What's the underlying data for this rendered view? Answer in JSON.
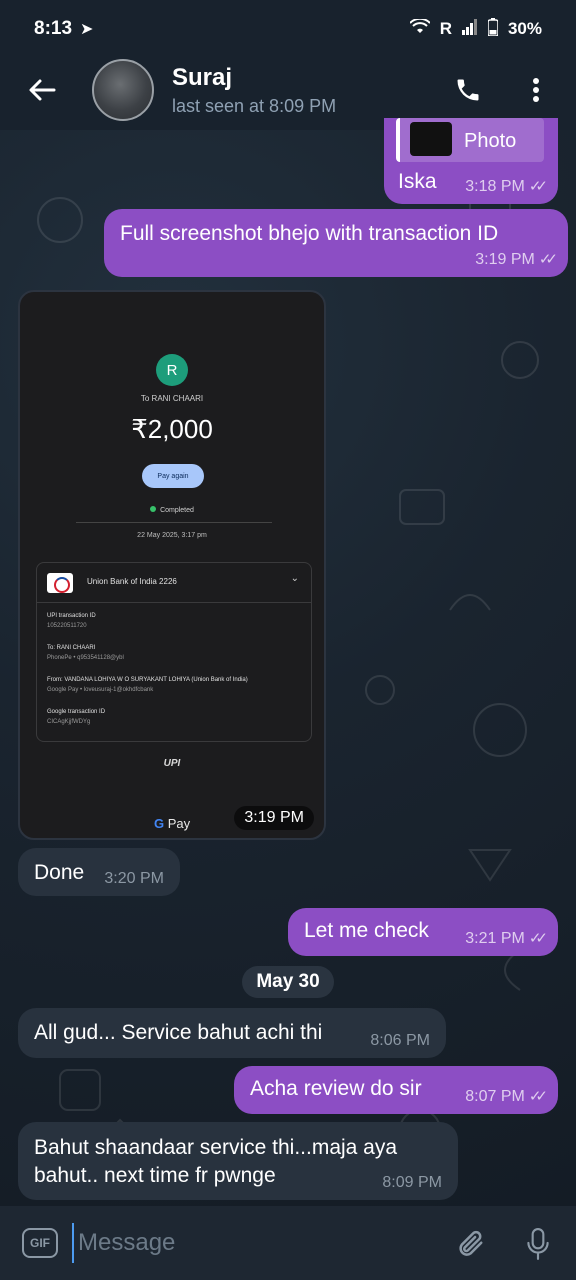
{
  "status_bar": {
    "time": "8:13",
    "network": "R",
    "battery": "30%"
  },
  "header": {
    "contact_name": "Suraj",
    "last_seen": "last seen at 8:09 PM"
  },
  "messages": [
    {
      "id": "m1",
      "reply_label": "Photo",
      "text": "Iska",
      "time": "3:18 PM",
      "direction": "out"
    },
    {
      "id": "m2",
      "text": "Full screenshot bhejo with transaction ID",
      "time": "3:19 PM",
      "direction": "out"
    },
    {
      "id": "m3",
      "type": "image",
      "time": "3:19 PM",
      "direction": "in"
    },
    {
      "id": "m4",
      "text": "Done",
      "time": "3:20 PM",
      "direction": "in"
    },
    {
      "id": "m5",
      "text": "Let me check",
      "time": "3:21 PM",
      "direction": "out"
    },
    {
      "id": "m6",
      "text": "All gud... Service bahut achi thi",
      "time": "8:06 PM",
      "direction": "in"
    },
    {
      "id": "m7",
      "text": "Acha review do sir",
      "time": "8:07 PM",
      "direction": "out"
    },
    {
      "id": "m8",
      "text_line1": "Bahut shaandaar service thi...maja aya",
      "text_line2": "bahut.. next time fr pwnge",
      "time": "8:09 PM",
      "direction": "in"
    }
  ],
  "date_chip": "May 30",
  "payment_screenshot": {
    "avatar_letter": "R",
    "to": "To RANI  CHAARI",
    "amount": "₹2,000",
    "pay_again": "Pay again",
    "status": "Completed",
    "date": "22 May 2025, 3:17 pm",
    "bank": "Union Bank of India 2226",
    "upi_label": "UPI transaction ID",
    "upi_value": "105220511720",
    "to_label": "To: RANI  CHAARI",
    "to_value": "PhonePe • q953541128@ybl",
    "from_label": "From: VANDANA LOHIYA W O SURYAKANT LOHIYA (Union Bank of India)",
    "from_value": "Google Pay • loveusuraj-1@okhdfcbank",
    "google_label": "Google transaction ID",
    "google_value": "CICAgKjjfWDYg",
    "upi_logo": "UPI",
    "gpay_text": "Pay"
  },
  "composer": {
    "placeholder": "Message",
    "gif_label": "GIF"
  },
  "ticks": "✓✓",
  "colors": {
    "outgoing": "#8c4ec4",
    "incoming": "#28323e",
    "background": "#18222d"
  }
}
